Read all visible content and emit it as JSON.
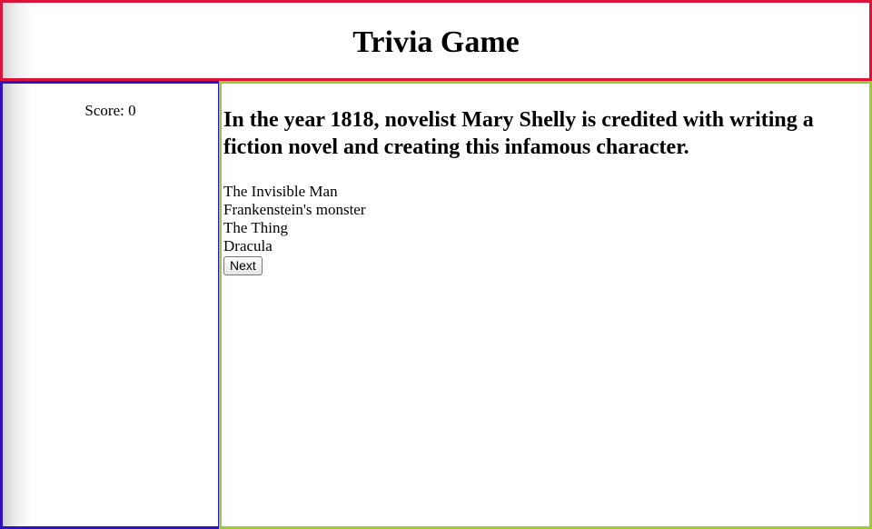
{
  "header": {
    "title": "Trivia Game"
  },
  "sidebar": {
    "score_label": "Score:",
    "score_value": "0"
  },
  "main": {
    "question": "In the year 1818, novelist Mary Shelly is credited with writing a fiction novel and creating this infamous character.",
    "answers": [
      "The Invisible Man",
      "Frankenstein's monster",
      "The Thing",
      "Dracula"
    ],
    "next_label": "Next"
  },
  "colors": {
    "header_border": "#dc143c",
    "sidebar_border": "#2f0fbf",
    "main_border": "#9acd32"
  }
}
